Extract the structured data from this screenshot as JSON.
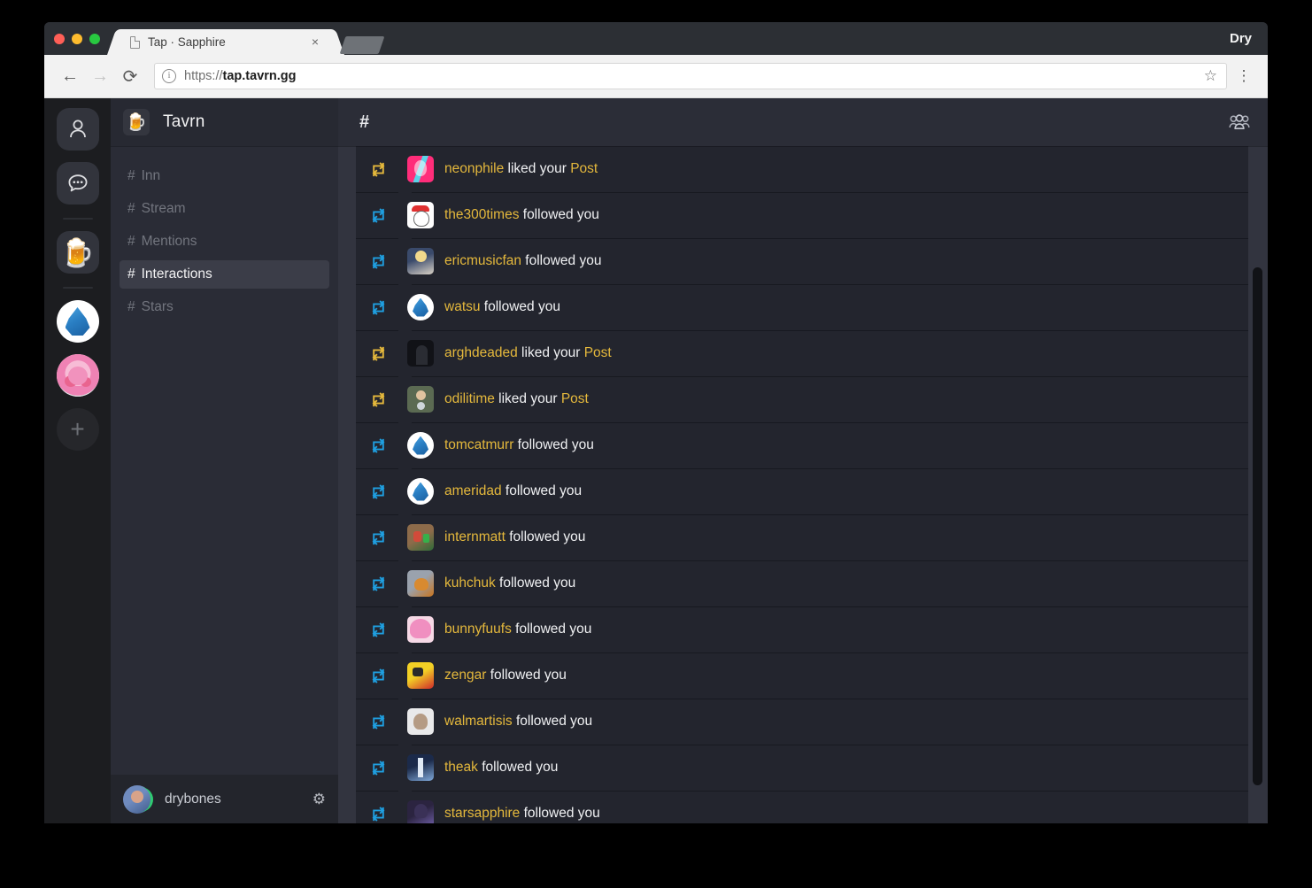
{
  "browser": {
    "tab": {
      "title": "Tap · Sapphire",
      "doc_icon": "document-icon",
      "close_icon": "×"
    },
    "profile_label": "Dry",
    "nav": {
      "back": "←",
      "forward": "→",
      "reload": "⟳"
    },
    "omnibox": {
      "info_icon": "ⓘ",
      "url_prefix": "https://",
      "url_domain": "tap.tavrn.gg",
      "star_icon": "☆",
      "menu_icon": "kebab-menu-icon"
    }
  },
  "server_rail": {
    "items": [
      {
        "name": "friends-icon",
        "glyph": "person-icon",
        "active": false
      },
      {
        "name": "direct-messages-icon",
        "glyph": "speech-bubble-icon",
        "active": false
      },
      {
        "name": "server-tavrn",
        "glyph": "🍺",
        "active": true
      },
      {
        "name": "server-sapphire",
        "glyph": "drop-icon",
        "active": false
      },
      {
        "name": "server-kirby",
        "glyph": "kirby-avatar",
        "active": false
      },
      {
        "name": "add-server-button",
        "glyph": "+",
        "active": false
      }
    ]
  },
  "sidebar": {
    "guild_name": "Tavrn",
    "guild_icon": "🍺",
    "channels": [
      {
        "hash": "#",
        "label": "Inn",
        "active": false
      },
      {
        "hash": "#",
        "label": "Stream",
        "active": false
      },
      {
        "hash": "#",
        "label": "Mentions",
        "active": false
      },
      {
        "hash": "#",
        "label": "Interactions",
        "active": true
      },
      {
        "hash": "#",
        "label": "Stars",
        "active": false
      }
    ],
    "user": {
      "name": "drybones",
      "status": "online",
      "settings_icon": "⚙"
    }
  },
  "main": {
    "header": {
      "hash": "#",
      "members_icon": "members-icon"
    },
    "colors": {
      "accent_yellow": "#e4b83c",
      "accent_blue": "#1f9fe0",
      "background": "#23252e",
      "sidebar": "#2a2c36",
      "rail": "#1c1d20",
      "active_channel": "#3b3d48"
    },
    "feed": [
      {
        "user": "neonphile",
        "action": "liked your",
        "object": "Post",
        "icon": "retweet-icon",
        "icon_color": "#e4b83c",
        "avatar": "av-neonphile",
        "shape": "square"
      },
      {
        "user": "the300times",
        "action": "followed you",
        "object": "",
        "icon": "retweet-icon",
        "icon_color": "#1f9fe0",
        "avatar": "av-300times",
        "shape": "square"
      },
      {
        "user": "ericmusicfan",
        "action": "followed you",
        "object": "",
        "icon": "retweet-icon",
        "icon_color": "#1f9fe0",
        "avatar": "av-ericmusic",
        "shape": "square"
      },
      {
        "user": "watsu",
        "action": "followed you",
        "object": "",
        "icon": "retweet-icon",
        "icon_color": "#1f9fe0",
        "avatar": "av-drop",
        "shape": "circle"
      },
      {
        "user": "arghdeaded",
        "action": "liked your",
        "object": "Post",
        "icon": "retweet-icon",
        "icon_color": "#e4b83c",
        "avatar": "av-arghdeaded",
        "shape": "square"
      },
      {
        "user": "odilitime",
        "action": "liked your",
        "object": "Post",
        "icon": "retweet-icon",
        "icon_color": "#e4b83c",
        "avatar": "av-odilitime",
        "shape": "square"
      },
      {
        "user": "tomcatmurr",
        "action": "followed you",
        "object": "",
        "icon": "retweet-icon",
        "icon_color": "#1f9fe0",
        "avatar": "av-drop",
        "shape": "circle"
      },
      {
        "user": "ameridad",
        "action": "followed you",
        "object": "",
        "icon": "retweet-icon",
        "icon_color": "#1f9fe0",
        "avatar": "av-drop",
        "shape": "circle"
      },
      {
        "user": "internmatt",
        "action": "followed you",
        "object": "",
        "icon": "retweet-icon",
        "icon_color": "#1f9fe0",
        "avatar": "av-internmatt",
        "shape": "square"
      },
      {
        "user": "kuhchuk",
        "action": "followed you",
        "object": "",
        "icon": "retweet-icon",
        "icon_color": "#1f9fe0",
        "avatar": "av-kuhchuk",
        "shape": "square"
      },
      {
        "user": "bunnyfuufs",
        "action": "followed you",
        "object": "",
        "icon": "retweet-icon",
        "icon_color": "#1f9fe0",
        "avatar": "av-bunnyfuufs",
        "shape": "square"
      },
      {
        "user": "zengar",
        "action": "followed you",
        "object": "",
        "icon": "retweet-icon",
        "icon_color": "#1f9fe0",
        "avatar": "av-zengar",
        "shape": "square"
      },
      {
        "user": "walmartisis",
        "action": "followed you",
        "object": "",
        "icon": "retweet-icon",
        "icon_color": "#1f9fe0",
        "avatar": "av-walmartisis",
        "shape": "square"
      },
      {
        "user": "theak",
        "action": "followed you",
        "object": "",
        "icon": "retweet-icon",
        "icon_color": "#1f9fe0",
        "avatar": "av-theak",
        "shape": "square"
      },
      {
        "user": "starsapphire",
        "action": "followed you",
        "object": "",
        "icon": "retweet-icon",
        "icon_color": "#1f9fe0",
        "avatar": "av-starsapphire",
        "shape": "square"
      }
    ]
  }
}
